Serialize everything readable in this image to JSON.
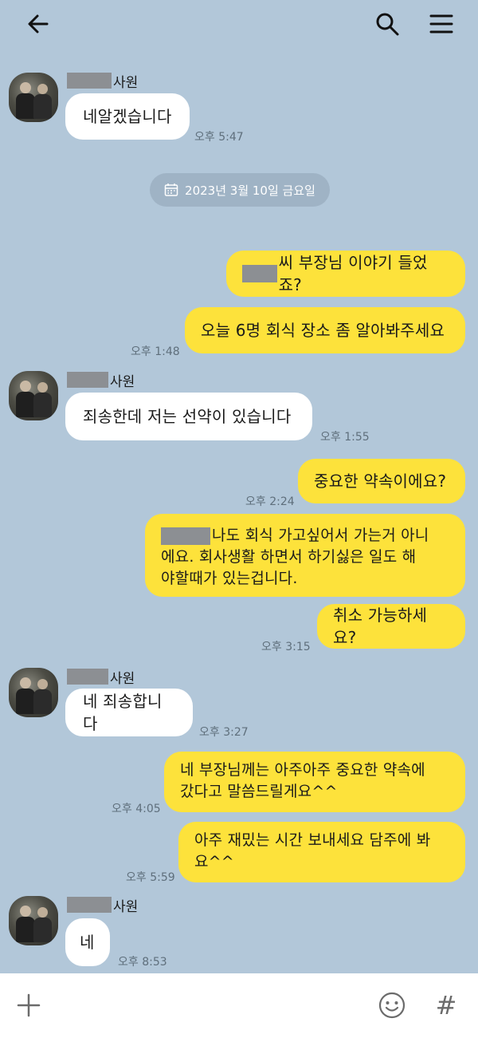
{
  "header": {
    "back_icon": "arrow-left-icon",
    "search_icon": "search-icon",
    "menu_icon": "hamburger-menu-icon"
  },
  "date_divider": "2023년 3월 10일 금요일",
  "sender_suffix": "사원",
  "messages": [
    {
      "side": "in",
      "text": "네알겠습니다",
      "time": "오후 5:47"
    },
    {
      "side": "out",
      "text": "씨 부장님 이야기 들었죠?"
    },
    {
      "side": "out",
      "text": "오늘 6명 회식 장소 좀 알아봐주세요",
      "time": "오후 1:48"
    },
    {
      "side": "in",
      "text": "죄송한데 저는 선약이 있습니다",
      "time": "오후 1:55"
    },
    {
      "side": "out",
      "text": "중요한 약속이에요?",
      "time": "오후 2:24"
    },
    {
      "side": "out",
      "line1": "나도 회식 가고싶어서 가는거 아니",
      "line2": "에요. 회사생활 하면서 하기싫은 일도 해",
      "line3": "야할때가 있는겁니다."
    },
    {
      "side": "out",
      "text": "취소 가능하세요?",
      "time": "오후 3:15"
    },
    {
      "side": "in",
      "text": "네 죄송합니다",
      "time": "오후 3:27"
    },
    {
      "side": "out",
      "line1": "네 부장님께는 아주아주 중요한 약속에",
      "line2": "갔다고 말씀드릴게요^^",
      "time": "오후 4:05"
    },
    {
      "side": "out",
      "line1": "아주 재밌는 시간 보내세요 담주에 봐",
      "line2": "요^^",
      "time": "오후 5:59"
    },
    {
      "side": "in",
      "text": "네",
      "time": "오후 8:53"
    }
  ],
  "footer": {
    "plus_icon": "plus-icon",
    "emoji_icon": "emoji-icon",
    "hash_symbol": "#"
  },
  "colors": {
    "background": "#b2c7d9",
    "outgoing_bubble": "#fde23b",
    "incoming_bubble": "#ffffff"
  }
}
